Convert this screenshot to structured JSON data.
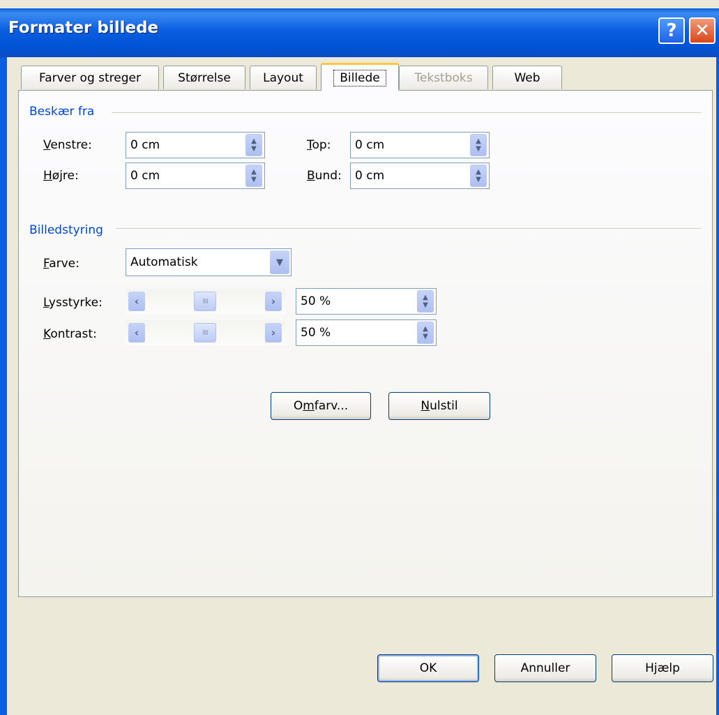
{
  "window": {
    "title": "Formater billede"
  },
  "titlebar_buttons": {
    "help_label": "?",
    "close_label": "✕"
  },
  "tabs": [
    {
      "label": "Farver og streger",
      "state": "normal"
    },
    {
      "label": "Størrelse",
      "state": "normal"
    },
    {
      "label": "Layout",
      "state": "normal"
    },
    {
      "label": "Billede",
      "state": "active"
    },
    {
      "label": "Tekstboks",
      "state": "disabled"
    },
    {
      "label": "Web",
      "state": "normal"
    }
  ],
  "crop": {
    "title": "Beskær fra",
    "left": {
      "label_first": "V",
      "label_rest": "enstre:",
      "value": "0 cm"
    },
    "right": {
      "label_first": "H",
      "label_rest": "øjre:",
      "value": "0 cm"
    },
    "top": {
      "label_first": "T",
      "label_rest": "op:",
      "value": "0 cm"
    },
    "bottom": {
      "label_first": "B",
      "label_rest": "und:",
      "value": "0 cm"
    }
  },
  "image_control": {
    "title": "Billedstyring",
    "color": {
      "label_first": "F",
      "label_rest": "arve:",
      "value": "Automatisk"
    },
    "brightness": {
      "label_first": "L",
      "label_rest": "ysstyrke:",
      "value": "50 %",
      "level_percent": 50
    },
    "contrast": {
      "label_first": "K",
      "label_rest": "ontrast:",
      "value": "50 %",
      "level_percent": 50
    }
  },
  "actions": {
    "recolor": {
      "pre": "O",
      "accel": "m",
      "post": "farv..."
    },
    "reset": {
      "accel": "N",
      "post": "ulstil"
    }
  },
  "footer": {
    "ok": "OK",
    "cancel": "Annuller",
    "help": "Hjælp"
  },
  "colors": {
    "title_bar": "#0b5ee0",
    "group_title": "#0046d5",
    "active_tab_accent": "#ffc83c"
  }
}
